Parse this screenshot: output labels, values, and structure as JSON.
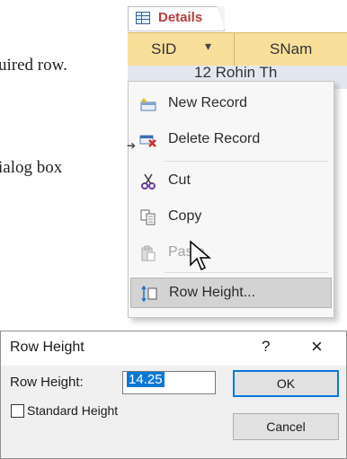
{
  "document": {
    "line1": "uired row.",
    "line2": "ialog box"
  },
  "datasheet": {
    "tab_label": "Details",
    "columns": [
      "SID",
      "SNam"
    ],
    "dropdown_glyph": "▾",
    "peek_row_text": "12 Rohin Th"
  },
  "context_menu": {
    "gutter_glyph": "➔",
    "items": [
      {
        "label": "New Record",
        "icon": "new-record-icon",
        "enabled": true
      },
      {
        "label": "Delete Record",
        "icon": "delete-record-icon",
        "enabled": true
      },
      {
        "label": "Cut",
        "icon": "scissors-icon",
        "enabled": true
      },
      {
        "label": "Copy",
        "icon": "copy-icon",
        "enabled": true
      },
      {
        "label": "Paste",
        "icon": "paste-icon",
        "enabled": false
      },
      {
        "label": "Row Height...",
        "icon": "row-height-icon",
        "enabled": true,
        "highlighted": true
      }
    ]
  },
  "dialog": {
    "title": "Row Height",
    "help_glyph": "?",
    "close_glyph": "×",
    "row_height_label": "Row Height:",
    "row_height_value": "14.25",
    "standard_height_label": "Standard Height",
    "standard_height_checked": false,
    "ok_label": "OK",
    "cancel_label": "Cancel"
  },
  "colors": {
    "header_bg": "#f8df9a",
    "tab_text": "#b33d3d",
    "selection": "#0a78d7"
  }
}
